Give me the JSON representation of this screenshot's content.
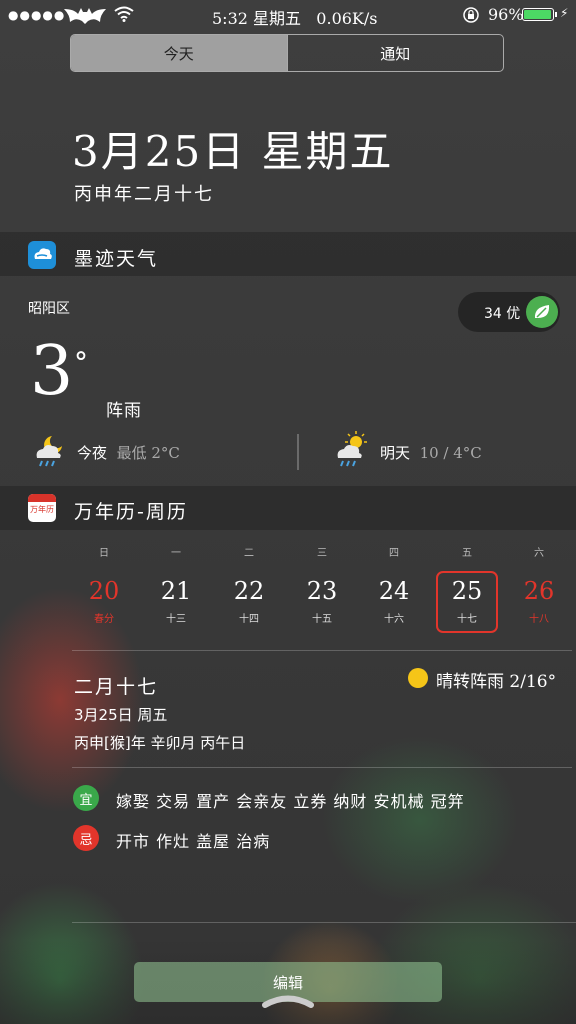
{
  "status": {
    "signal": "●●●●●",
    "time": "5:32 星期五",
    "speed": "0.06K/s",
    "battery_pct": "96%",
    "battery_level": 0.96
  },
  "tabs": {
    "today": "今天",
    "notifications": "通知"
  },
  "header": {
    "date": "3月25日 星期五",
    "lunar": "丙申年二月十七"
  },
  "weather": {
    "app_name": "墨迹天气",
    "district": "昭阳区",
    "aqi": "34 优",
    "temp": "3",
    "deg": "°",
    "condition": "阵雨",
    "tonight_label": "今夜",
    "tonight_value": "最低 2°C",
    "tomorrow_label": "明天",
    "tomorrow_value": "10 / 4°C"
  },
  "calendar": {
    "app_name": "万年历-周历",
    "app_icon_text": "万年历",
    "weekdays": [
      "日",
      "一",
      "二",
      "三",
      "四",
      "五",
      "六"
    ],
    "days": [
      {
        "num": "20",
        "sub": "春分",
        "red": true
      },
      {
        "num": "21",
        "sub": "十三",
        "red": false
      },
      {
        "num": "22",
        "sub": "十四",
        "red": false
      },
      {
        "num": "23",
        "sub": "十五",
        "red": false
      },
      {
        "num": "24",
        "sub": "十六",
        "red": false
      },
      {
        "num": "25",
        "sub": "十七",
        "red": false
      },
      {
        "num": "26",
        "sub": "十八",
        "red": true
      }
    ],
    "selected_day": "25",
    "lunar_date": "二月十七",
    "solar_date": "3月25日  周五",
    "ganzhi": "丙申[猴]年  辛卯月  丙午日",
    "weather": "晴转阵雨 2/16°",
    "yi_label": "宜",
    "yi": "嫁娶 交易 置产 会亲友 立券 纳财 安机械 冠笄",
    "ji_label": "忌",
    "ji": "开市 作灶 盖屋 治病"
  },
  "edit_label": "编辑"
}
